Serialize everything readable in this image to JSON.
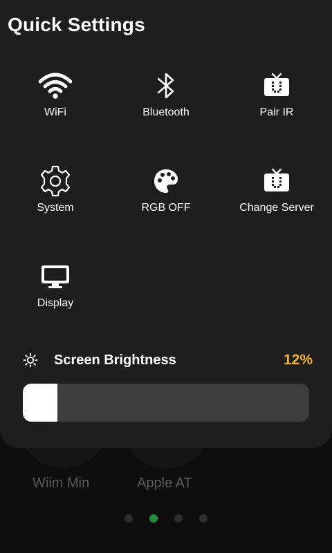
{
  "panel": {
    "title": "Quick Settings"
  },
  "tiles": [
    {
      "label": "WiFi",
      "icon": "wifi-icon"
    },
    {
      "label": "Bluetooth",
      "icon": "bluetooth-icon"
    },
    {
      "label": "Pair IR",
      "icon": "tv-icon"
    },
    {
      "label": "System",
      "icon": "gear-icon"
    },
    {
      "label": "RGB OFF",
      "icon": "palette-icon"
    },
    {
      "label": "Change Server",
      "icon": "tv-icon"
    },
    {
      "label": "Display",
      "icon": "monitor-icon"
    }
  ],
  "brightness": {
    "label": "Screen Brightness",
    "value_text": "12%",
    "value": 0.12,
    "icon": "sun-icon",
    "accent_color": "#f2b31a"
  },
  "background_app": {
    "items": [
      {
        "label": "Wiim Min"
      },
      {
        "label": "Apple AT"
      }
    ],
    "pages": 4,
    "active_page": 2,
    "active_color": "#1e8e3e"
  }
}
